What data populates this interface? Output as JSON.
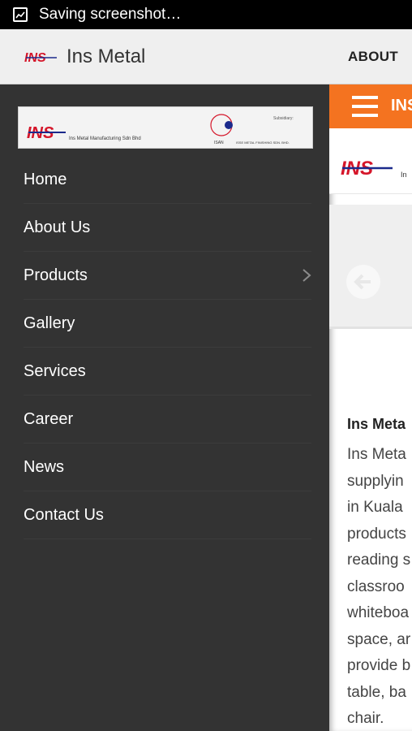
{
  "status_bar": {
    "text": "Saving screenshot…",
    "icon": "screenshot-icon"
  },
  "action_bar": {
    "title": "Ins Metal",
    "about": "ABOUT",
    "logo_text": "INS"
  },
  "drawer": {
    "banner": {
      "logo_text": "INS",
      "company": "Ins Metal Manufacturing Sdn Bhd",
      "subsidiary_label": "Subsidiary:",
      "sub_logo_text": "ISAN",
      "sub_company": "ISSE METAL FINISHING SDN. BHD."
    },
    "items": [
      {
        "label": "Home"
      },
      {
        "label": "About Us"
      },
      {
        "label": "Products",
        "has_children": true
      },
      {
        "label": "Gallery"
      },
      {
        "label": "Services"
      },
      {
        "label": "Career"
      },
      {
        "label": "News"
      },
      {
        "label": "Contact Us"
      }
    ]
  },
  "content": {
    "header_text": "INS",
    "logo_text": "INS",
    "logo_sub": "In",
    "about_title": "Ins Meta",
    "about_lines": [
      "Ins Meta",
      "supplyin",
      "in Kuala",
      "products",
      "reading s",
      "classroo",
      "whiteboa",
      "space, ar",
      "provide b",
      "table, ba",
      "chair."
    ]
  },
  "colors": {
    "brand_red": "#d5162a",
    "brand_blue": "#1b2a8c",
    "accent_orange": "#f47320"
  }
}
